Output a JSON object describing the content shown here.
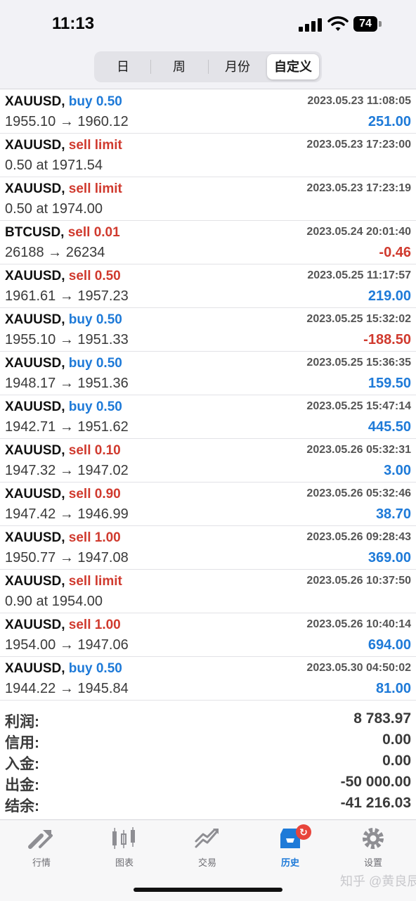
{
  "status": {
    "time": "11:13",
    "battery": "74"
  },
  "segments": [
    {
      "label": "日"
    },
    {
      "label": "周"
    },
    {
      "label": "月份"
    },
    {
      "label": "自定义",
      "active": true
    }
  ],
  "trades": [
    {
      "symbol": "XAUUSD,",
      "action": "buy 0.50",
      "side": "buy",
      "time": "2023.05.23 11:08:05",
      "detail": "1955.10 → 1960.12",
      "profit": "251.00"
    },
    {
      "symbol": "XAUUSD,",
      "action": "sell limit",
      "side": "sell",
      "time": "2023.05.23 17:23:00",
      "detail": "0.50 at 1971.54",
      "profit": ""
    },
    {
      "symbol": "XAUUSD,",
      "action": "sell limit",
      "side": "sell",
      "time": "2023.05.23 17:23:19",
      "detail": "0.50 at 1974.00",
      "profit": ""
    },
    {
      "symbol": "BTCUSD,",
      "action": "sell 0.01",
      "side": "sell",
      "time": "2023.05.24 20:01:40",
      "detail": "26188 → 26234",
      "profit": "-0.46"
    },
    {
      "symbol": "XAUUSD,",
      "action": "sell 0.50",
      "side": "sell",
      "time": "2023.05.25 11:17:57",
      "detail": "1961.61 → 1957.23",
      "profit": "219.00"
    },
    {
      "symbol": "XAUUSD,",
      "action": "buy 0.50",
      "side": "buy",
      "time": "2023.05.25 15:32:02",
      "detail": "1955.10 → 1951.33",
      "profit": "-188.50"
    },
    {
      "symbol": "XAUUSD,",
      "action": "buy 0.50",
      "side": "buy",
      "time": "2023.05.25 15:36:35",
      "detail": "1948.17 → 1951.36",
      "profit": "159.50"
    },
    {
      "symbol": "XAUUSD,",
      "action": "buy 0.50",
      "side": "buy",
      "time": "2023.05.25 15:47:14",
      "detail": "1942.71 → 1951.62",
      "profit": "445.50"
    },
    {
      "symbol": "XAUUSD,",
      "action": "sell 0.10",
      "side": "sell",
      "time": "2023.05.26 05:32:31",
      "detail": "1947.32 → 1947.02",
      "profit": "3.00"
    },
    {
      "symbol": "XAUUSD,",
      "action": "sell 0.90",
      "side": "sell",
      "time": "2023.05.26 05:32:46",
      "detail": "1947.42 → 1946.99",
      "profit": "38.70"
    },
    {
      "symbol": "XAUUSD,",
      "action": "sell 1.00",
      "side": "sell",
      "time": "2023.05.26 09:28:43",
      "detail": "1950.77 → 1947.08",
      "profit": "369.00"
    },
    {
      "symbol": "XAUUSD,",
      "action": "sell limit",
      "side": "sell",
      "time": "2023.05.26 10:37:50",
      "detail": "0.90 at 1954.00",
      "profit": ""
    },
    {
      "symbol": "XAUUSD,",
      "action": "sell 1.00",
      "side": "sell",
      "time": "2023.05.26 10:40:14",
      "detail": "1954.00 → 1947.06",
      "profit": "694.00"
    },
    {
      "symbol": "XAUUSD,",
      "action": "buy 0.50",
      "side": "buy",
      "time": "2023.05.30 04:50:02",
      "detail": "1944.22 → 1945.84",
      "profit": "81.00"
    }
  ],
  "summary": [
    {
      "label": "利润:",
      "value": "8 783.97"
    },
    {
      "label": "信用:",
      "value": "0.00"
    },
    {
      "label": "入金:",
      "value": "0.00"
    },
    {
      "label": "出金:",
      "value": "-50 000.00"
    },
    {
      "label": "结余:",
      "value": "-41 216.03"
    }
  ],
  "tabs": [
    {
      "label": "行情",
      "icon": "quotes-icon"
    },
    {
      "label": "图表",
      "icon": "chart-icon"
    },
    {
      "label": "交易",
      "icon": "trade-icon"
    },
    {
      "label": "历史",
      "icon": "history-icon",
      "active": true,
      "badge": "↻"
    },
    {
      "label": "设置",
      "icon": "gear-icon"
    }
  ],
  "watermark": "知乎 @黄良辰",
  "colors": {
    "buy": "#1e7ad8",
    "sell": "#d03a2e",
    "profit_positive": "#1e7ad8",
    "profit_negative": "#d03a2e",
    "active_tab": "#1e7ad8"
  }
}
